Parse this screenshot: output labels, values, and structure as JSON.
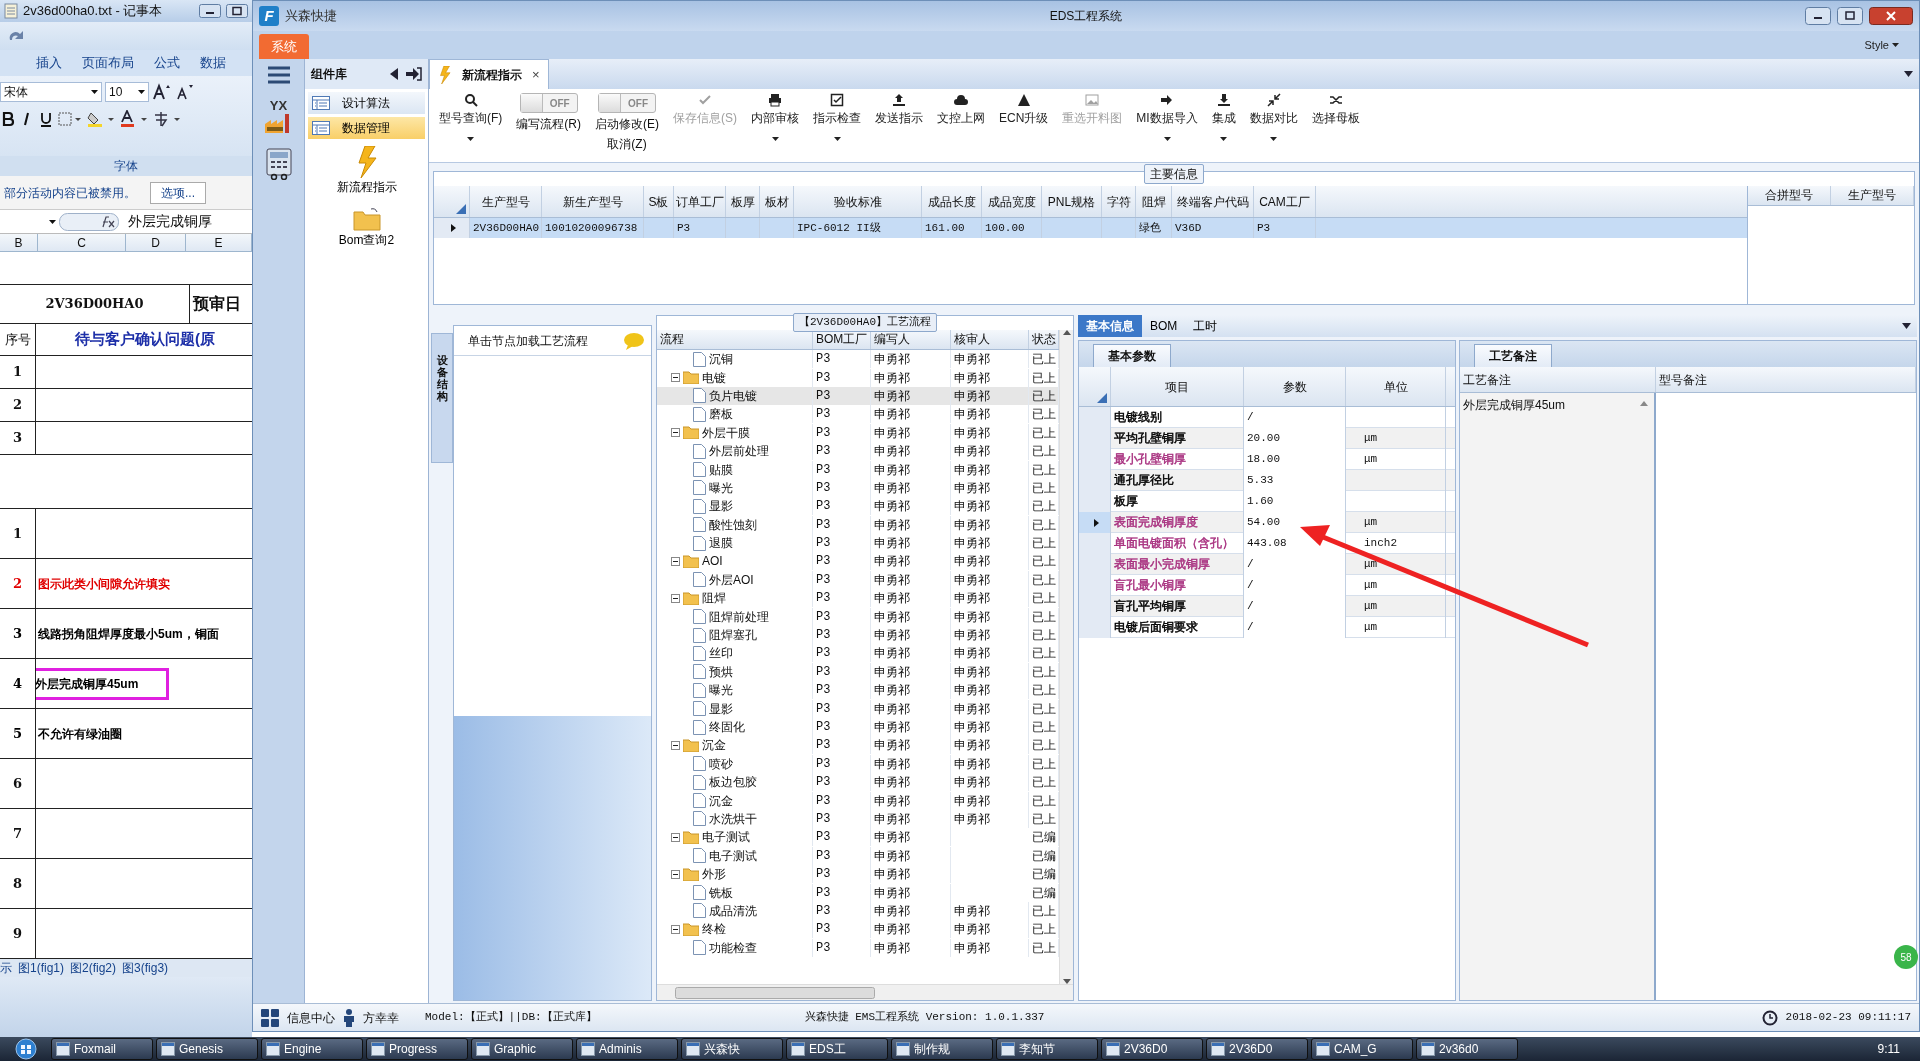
{
  "notepad": {
    "title": "2v36d00ha0.txt - 记事本"
  },
  "excel": {
    "ribbon_tabs": [
      "插入",
      "页面布局",
      "公式",
      "数据"
    ],
    "font_name": "宋体",
    "font_size": "10",
    "group_label": "字体",
    "security_message": "部分活动内容已被禁用。",
    "options_button": "选项...",
    "formula": "外层完成铜厚",
    "columns": [
      "B",
      "C",
      "D",
      "E"
    ],
    "title_row": [
      "2V36D00HA0",
      "预审日"
    ],
    "header_row": [
      "序号",
      "待与客户确认问题(原"
    ],
    "rows": [
      {
        "kind": "small",
        "no": "1"
      },
      {
        "kind": "small",
        "no": "2"
      },
      {
        "kind": "small",
        "no": "3"
      },
      {
        "kind": "spacer"
      },
      {
        "kind": "large",
        "no": "1"
      },
      {
        "kind": "large",
        "no": "2",
        "text": "图示此类小间隙允许填实",
        "color": "#e00000",
        "highlighted": false
      },
      {
        "kind": "large",
        "no": "3",
        "text": "线路拐角阻焊厚度最小5um，铜面",
        "color": "#000000",
        "highlighted": false
      },
      {
        "kind": "large",
        "no": "4",
        "text": "外层完成铜厚45um",
        "color": "#000000",
        "highlighted": true
      },
      {
        "kind": "large",
        "no": "5",
        "text": "不允许有绿油圈",
        "color": "#000000",
        "highlighted": false
      },
      {
        "kind": "large",
        "no": "6"
      },
      {
        "kind": "large",
        "no": "7"
      },
      {
        "kind": "large",
        "no": "8"
      },
      {
        "kind": "large",
        "no": "9"
      }
    ],
    "sheet_tabs": [
      "示",
      "图1(fig1)",
      "图2(fig2)",
      "图3(fig3)"
    ]
  },
  "app": {
    "logo": "F",
    "title": "兴森快捷",
    "center_title": "EDS工程系统",
    "system_tab": "系统",
    "style_label": "Style",
    "rail_badge": "YX"
  },
  "components": {
    "title": "组件库",
    "items": [
      {
        "label": "设计算法",
        "selected": false
      },
      {
        "label": "数据管理",
        "selected": true
      }
    ],
    "tools": [
      "新流程指示",
      "Bom查询2"
    ]
  },
  "doc_tab": {
    "label": "新流程指示",
    "close": "×"
  },
  "toolbar": [
    {
      "kind": "button",
      "label": "型号查询(F)",
      "caret": true,
      "disabled": false
    },
    {
      "kind": "toggle",
      "label": "编写流程(R)",
      "switch_text": "OFF",
      "on": false
    },
    {
      "kind": "toggle",
      "label": "启动修改(E)",
      "sub_label": "取消(Z)",
      "switch_text": "OFF",
      "on": false
    },
    {
      "kind": "button",
      "label": "保存信息(S)",
      "caret": false,
      "disabled": true
    },
    {
      "kind": "button",
      "label": "内部审核",
      "caret": true,
      "disabled": false
    },
    {
      "kind": "button",
      "label": "指示检查",
      "caret": true,
      "disabled": false
    },
    {
      "kind": "button",
      "label": "发送指示",
      "caret": false,
      "disabled": false
    },
    {
      "kind": "button",
      "label": "文控上网",
      "caret": false,
      "disabled": false
    },
    {
      "kind": "button",
      "label": "ECN升级",
      "caret": false,
      "disabled": false
    },
    {
      "kind": "button",
      "label": "重选开料图",
      "caret": false,
      "disabled": true
    },
    {
      "kind": "button",
      "label": "MI数据导入",
      "caret": true,
      "disabled": false
    },
    {
      "kind": "button",
      "label": "集成",
      "caret": true,
      "disabled": false
    },
    {
      "kind": "button",
      "label": "数据对比",
      "caret": true,
      "disabled": false
    },
    {
      "kind": "button",
      "label": "选择母板",
      "caret": false,
      "disabled": false
    }
  ],
  "main_info": {
    "legend": "主要信息",
    "columns": [
      "生产型号",
      "新生产型号",
      "S板",
      "订单工厂",
      "板厚",
      "板材",
      "验收标准",
      "成品长度",
      "成品宽度",
      "PNL规格",
      "字符",
      "阻焊",
      "终端客户代码",
      "CAM工厂"
    ],
    "rows": [
      {
        "selected": true,
        "cells": [
          "2V36D00HA0",
          "10010200096738",
          null,
          "P3",
          null,
          null,
          "IPC-6012 II级",
          "161.00",
          "100.00",
          null,
          null,
          "绿色",
          "V36D",
          "P3"
        ]
      }
    ],
    "side_columns": [
      "合拼型号",
      "生产型号"
    ]
  },
  "left_panel": {
    "vertical_tab": "设备结构",
    "hint": "单击节点加载工艺流程"
  },
  "flow": {
    "title": "【2V36D00HA0】工艺流程",
    "columns": [
      "流程",
      "BOM工厂",
      "编写人",
      "核审人",
      "状态"
    ],
    "tree": [
      {
        "children": [
          {
            "label": "沉铜",
            "bom": "P3",
            "writer": "申勇祁",
            "reviewer": "申勇祁",
            "status": "已上",
            "selected": false
          }
        ]
      },
      {
        "label": "电镀",
        "bom": "P3",
        "writer": "申勇祁",
        "reviewer": "申勇祁",
        "status": "已上",
        "selected": false,
        "children": [
          {
            "label": "负片电镀",
            "bom": "P3",
            "writer": "申勇祁",
            "reviewer": "申勇祁",
            "status": "已上",
            "selected": true
          },
          {
            "label": "磨板",
            "bom": "P3",
            "writer": "申勇祁",
            "reviewer": "申勇祁",
            "status": "已上",
            "selected": false
          }
        ]
      },
      {
        "label": "外层干膜",
        "bom": "P3",
        "writer": "申勇祁",
        "reviewer": "申勇祁",
        "status": "已上",
        "selected": false,
        "children": [
          {
            "label": "外层前处理",
            "bom": "P3",
            "writer": "申勇祁",
            "reviewer": "申勇祁",
            "status": "已上",
            "selected": false
          },
          {
            "label": "贴膜",
            "bom": "P3",
            "writer": "申勇祁",
            "reviewer": "申勇祁",
            "status": "已上",
            "selected": false
          },
          {
            "label": "曝光",
            "bom": "P3",
            "writer": "申勇祁",
            "reviewer": "申勇祁",
            "status": "已上",
            "selected": false
          },
          {
            "label": "显影",
            "bom": "P3",
            "writer": "申勇祁",
            "reviewer": "申勇祁",
            "status": "已上",
            "selected": false
          },
          {
            "label": "酸性蚀刻",
            "bom": "P3",
            "writer": "申勇祁",
            "reviewer": "申勇祁",
            "status": "已上",
            "selected": false
          },
          {
            "label": "退膜",
            "bom": "P3",
            "writer": "申勇祁",
            "reviewer": "申勇祁",
            "status": "已上",
            "selected": false
          }
        ]
      },
      {
        "label": "AOI",
        "bom": "P3",
        "writer": "申勇祁",
        "reviewer": "申勇祁",
        "status": "已上",
        "selected": false,
        "children": [
          {
            "label": "外层AOI",
            "bom": "P3",
            "writer": "申勇祁",
            "reviewer": "申勇祁",
            "status": "已上",
            "selected": false
          }
        ]
      },
      {
        "label": "阻焊",
        "bom": "P3",
        "writer": "申勇祁",
        "reviewer": "申勇祁",
        "status": "已上",
        "selected": false,
        "children": [
          {
            "label": "阻焊前处理",
            "bom": "P3",
            "writer": "申勇祁",
            "reviewer": "申勇祁",
            "status": "已上",
            "selected": false
          },
          {
            "label": "阻焊塞孔",
            "bom": "P3",
            "writer": "申勇祁",
            "reviewer": "申勇祁",
            "status": "已上",
            "selected": false
          },
          {
            "label": "丝印",
            "bom": "P3",
            "writer": "申勇祁",
            "reviewer": "申勇祁",
            "status": "已上",
            "selected": false
          },
          {
            "label": "预烘",
            "bom": "P3",
            "writer": "申勇祁",
            "reviewer": "申勇祁",
            "status": "已上",
            "selected": false
          },
          {
            "label": "曝光",
            "bom": "P3",
            "writer": "申勇祁",
            "reviewer": "申勇祁",
            "status": "已上",
            "selected": false
          },
          {
            "label": "显影",
            "bom": "P3",
            "writer": "申勇祁",
            "reviewer": "申勇祁",
            "status": "已上",
            "selected": false
          },
          {
            "label": "终固化",
            "bom": "P3",
            "writer": "申勇祁",
            "reviewer": "申勇祁",
            "status": "已上",
            "selected": false
          }
        ]
      },
      {
        "label": "沉金",
        "bom": "P3",
        "writer": "申勇祁",
        "reviewer": "申勇祁",
        "status": "已上",
        "selected": false,
        "children": [
          {
            "label": "喷砂",
            "bom": "P3",
            "writer": "申勇祁",
            "reviewer": "申勇祁",
            "status": "已上",
            "selected": false
          },
          {
            "label": "板边包胶",
            "bom": "P3",
            "writer": "申勇祁",
            "reviewer": "申勇祁",
            "status": "已上",
            "selected": false
          },
          {
            "label": "沉金",
            "bom": "P3",
            "writer": "申勇祁",
            "reviewer": "申勇祁",
            "status": "已上",
            "selected": false
          },
          {
            "label": "水洗烘干",
            "bom": "P3",
            "writer": "申勇祁",
            "reviewer": "申勇祁",
            "status": "已上",
            "selected": false
          }
        ]
      },
      {
        "label": "电子测试",
        "bom": "P3",
        "writer": "申勇祁",
        "status": "已编",
        "selected": false,
        "children": [
          {
            "label": "电子测试",
            "bom": "P3",
            "writer": "申勇祁",
            "status": "已编",
            "selected": false
          }
        ]
      },
      {
        "label": "外形",
        "bom": "P3",
        "writer": "申勇祁",
        "status": "已编",
        "selected": false,
        "children": [
          {
            "label": "铣板",
            "bom": "P3",
            "writer": "申勇祁",
            "status": "已编",
            "selected": false
          },
          {
            "label": "成品清洗",
            "bom": "P3",
            "writer": "申勇祁",
            "reviewer": "申勇祁",
            "status": "已上",
            "selected": false
          }
        ]
      },
      {
        "label": "终检",
        "bom": "P3",
        "writer": "申勇祁",
        "reviewer": "申勇祁",
        "status": "已上",
        "selected": false,
        "children": [
          {
            "label": "功能检查",
            "bom": "P3",
            "writer": "申勇祁",
            "reviewer": "申勇祁",
            "status": "已上",
            "selected": false
          }
        ]
      }
    ]
  },
  "detail": {
    "tabs": [
      {
        "label": "基本信息",
        "selected": true
      },
      {
        "label": "BOM",
        "selected": false
      },
      {
        "label": "工时",
        "selected": false
      }
    ],
    "param_tab": "基本参数",
    "param_columns": [
      "项目",
      "参数",
      "单位"
    ],
    "params": [
      {
        "label": "电镀线别",
        "value": "/",
        "color": "#000000",
        "selected": false
      },
      {
        "label": "平均孔壁铜厚",
        "value": "20.00",
        "unit": "μm",
        "color": "#000000",
        "selected": false
      },
      {
        "label": "最小孔壁铜厚",
        "value": "18.00",
        "unit": "μm",
        "color": "#a8307f",
        "selected": false
      },
      {
        "label": "通孔厚径比",
        "value": "5.33",
        "color": "#000000",
        "selected": false
      },
      {
        "label": "板厚",
        "value": "1.60",
        "color": "#000000",
        "selected": false
      },
      {
        "label": "表面完成铜厚度",
        "value": "54.00",
        "unit": "μm",
        "color": "#a8307f",
        "selected": true
      },
      {
        "label": "单面电镀面积（含孔）",
        "value": "443.08",
        "unit": "inch2",
        "color": "#a8307f",
        "selected": false
      },
      {
        "label": "表面最小完成铜厚",
        "value": "/",
        "unit": "μm",
        "color": "#a8307f",
        "selected": false
      },
      {
        "label": "盲孔最小铜厚",
        "value": "/",
        "unit": "μm",
        "color": "#a8307f",
        "selected": false
      },
      {
        "label": "盲孔平均铜厚",
        "value": "/",
        "unit": "μm",
        "color": "#000000",
        "selected": false
      },
      {
        "label": "电镀后面铜要求",
        "value": "/",
        "unit": "μm",
        "color": "#000000",
        "selected": false
      }
    ],
    "notes_tab": "工艺备注",
    "notes_columns": [
      "工艺备注",
      "型号备注"
    ],
    "process_note": "外层完成铜厚45um"
  },
  "status_bar": {
    "info_center": "信息中心",
    "user": "方幸幸",
    "model": "Model:【正式】||DB:【正式库】",
    "version": "兴森快捷 EMS工程系统 Version: 1.0.1.337",
    "datetime": "2018-02-23 09:11:17"
  },
  "edge_badge": "58",
  "taskbar": {
    "items": [
      "Foxmail",
      "Genesis",
      "Engine",
      "Progress",
      "Graphic",
      "Adminis",
      "兴森快",
      "EDS工",
      "制作规",
      "李知节",
      "2V36D0",
      "2V36D0",
      "CAM_G",
      "2v36d0"
    ],
    "clock": "9:11"
  }
}
